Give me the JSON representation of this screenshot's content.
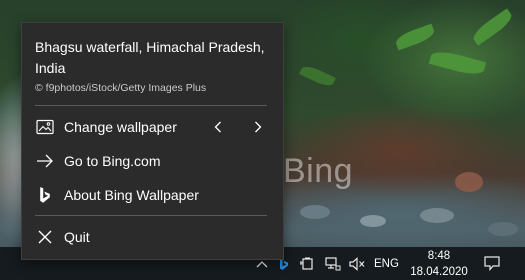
{
  "wallpaper": {
    "watermark": "Bing"
  },
  "menu": {
    "title": "Bhagsu waterfall, Himachal Pradesh, India",
    "credit": "© f9photos/iStock/Getty Images Plus",
    "items": [
      {
        "label": "Change wallpaper",
        "icon": "wallpaper-icon"
      },
      {
        "label": "Go to Bing.com",
        "icon": "arrow-right-icon"
      },
      {
        "label": "About Bing Wallpaper",
        "icon": "bing-logo-icon"
      },
      {
        "label": "Quit",
        "icon": "close-icon"
      }
    ],
    "prev_icon": "chevron-left-icon",
    "next_icon": "chevron-right-icon"
  },
  "taskbar": {
    "language": "ENG",
    "time": "8:48",
    "date": "18.04.2020",
    "icons": [
      "chevron-up-icon",
      "bing-tray-icon",
      "battery-icon",
      "network-icon",
      "volume-muted-icon",
      "notification-icon"
    ]
  },
  "colors": {
    "menu_bg": "#2b2b2b",
    "taskbar_bg": "#151b1e",
    "bing_blue": "#2b8ae0"
  }
}
